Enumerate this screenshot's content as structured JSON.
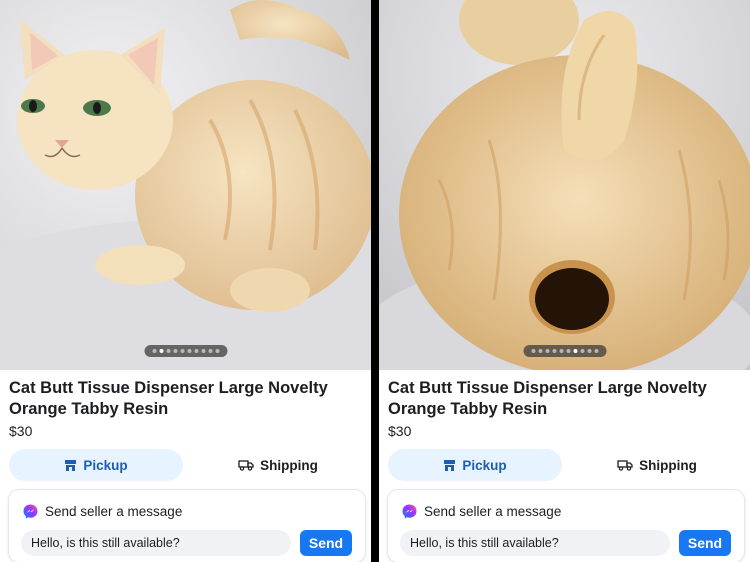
{
  "listings": [
    {
      "photo_desc": "cat-front-view",
      "carousel": {
        "total": 10,
        "active": 1
      },
      "title": "Cat Butt Tissue Dispenser Large Novelty Orange Tabby Resin",
      "price": "$30",
      "delivery": {
        "pickup_label": "Pickup",
        "shipping_label": "Shipping",
        "selected": "pickup"
      },
      "message": {
        "header": "Send seller a message",
        "input_value": "Hello, is this still available?",
        "send_label": "Send"
      }
    },
    {
      "photo_desc": "cat-rear-view",
      "carousel": {
        "total": 10,
        "active": 6
      },
      "title": "Cat Butt Tissue Dispenser Large Novelty Orange Tabby Resin",
      "price": "$30",
      "delivery": {
        "pickup_label": "Pickup",
        "shipping_label": "Shipping",
        "selected": "pickup"
      },
      "message": {
        "header": "Send seller a message",
        "input_value": "Hello, is this still available?",
        "send_label": "Send"
      }
    }
  ],
  "colors": {
    "accent": "#1877f2",
    "pickup_bg": "#e7f3ff",
    "pickup_text": "#1b5fb3",
    "text": "#1c1e21"
  }
}
